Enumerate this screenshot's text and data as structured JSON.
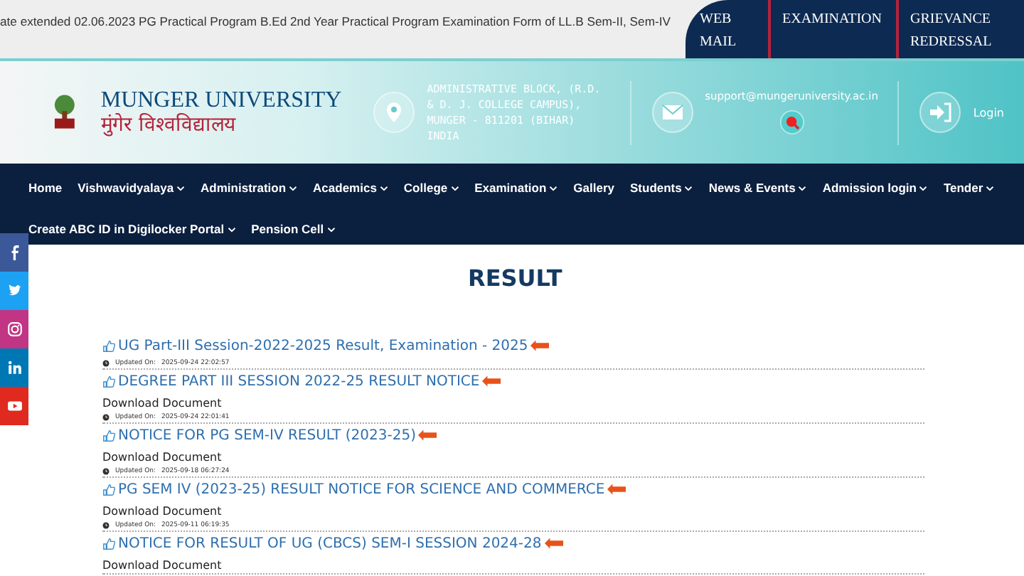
{
  "ticker": {
    "text": "ate extended 02.06.2023 PG Practical Program B.Ed 2nd Year Practical Program Examination Form of LL.B Sem-II, Sem-IV"
  },
  "top_links": [
    "WEB MAIL",
    "EXAMINATION",
    "GRIEVANCE REDRESSAL"
  ],
  "header": {
    "name": "MUNGER UNIVERSITY",
    "name_hindi": "मुंगेर विश्वविद्यालय",
    "address": "ADMINISTRATIVE BLOCK, (R.D. & D. J. COLLEGE CAMPUS), MUNGER - 811201 (BIHAR) INDIA",
    "email": "support@mungeruniversity.ac.in",
    "login": "Login"
  },
  "nav": [
    {
      "label": "Home",
      "dropdown": false
    },
    {
      "label": "Vishwavidyalaya",
      "dropdown": true
    },
    {
      "label": "Administration",
      "dropdown": true
    },
    {
      "label": "Academics",
      "dropdown": true
    },
    {
      "label": "College",
      "dropdown": true
    },
    {
      "label": "Examination",
      "dropdown": true
    },
    {
      "label": "Gallery",
      "dropdown": false
    },
    {
      "label": "Students",
      "dropdown": true
    },
    {
      "label": "News & Events",
      "dropdown": true
    },
    {
      "label": "Admission login",
      "dropdown": true
    },
    {
      "label": "Tender",
      "dropdown": true
    },
    {
      "label": "Create ABC ID in Digilocker Portal",
      "dropdown": true
    },
    {
      "label": "Pension Cell",
      "dropdown": true
    }
  ],
  "social": [
    {
      "kind": "facebook",
      "color": "#3b5998"
    },
    {
      "kind": "twitter",
      "color": "#1da1f2"
    },
    {
      "kind": "instagram",
      "color": "#c13584"
    },
    {
      "kind": "linkedin",
      "color": "#0077b5"
    },
    {
      "kind": "youtube",
      "color": "#e02a20"
    }
  ],
  "page_title": "RESULT",
  "results": [
    {
      "title": "UG Part-III Session-2022-2025 Result, Examination - 2025",
      "updated_label": "Updated On:",
      "updated": "2025-09-24 22:02:57"
    },
    {
      "title": "DEGREE PART III SESSION 2022-25 RESULT NOTICE",
      "download": "Download Document",
      "updated_label": "Updated On:",
      "updated": "2025-09-24 22:01:41"
    },
    {
      "title": "NOTICE FOR PG SEM-IV RESULT (2023-25)",
      "download": "Download Document",
      "updated_label": "Updated On:",
      "updated": "2025-09-18 06:27:24"
    },
    {
      "title": "PG SEM IV (2023-25) RESULT NOTICE FOR SCIENCE AND COMMERCE",
      "download": "Download Document",
      "updated_label": "Updated On:",
      "updated": "2025-09-11 06:19:35"
    },
    {
      "title": "NOTICE FOR RESULT OF UG (CBCS) SEM-I SESSION 2024-28",
      "download": "Download Document"
    }
  ]
}
